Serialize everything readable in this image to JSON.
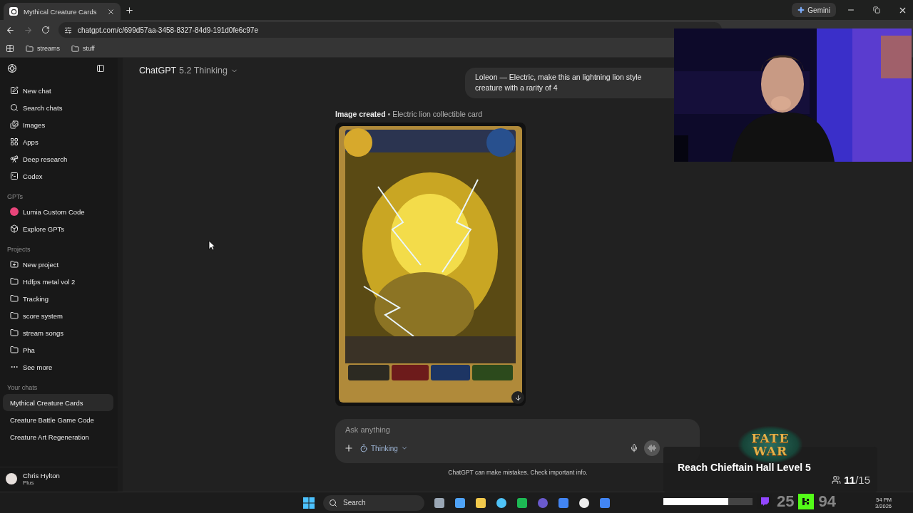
{
  "browser": {
    "tab": {
      "title": "Mythical Creature Cards",
      "selected": true
    },
    "gemini": "Gemini",
    "forward": {
      "disabled": true
    },
    "url": "chatgpt.com/c/699d57aa-3458-8327-84d9-191d0fe6c97e",
    "bookmarks": [
      {
        "label": "streams"
      },
      {
        "label": "stuff"
      }
    ]
  },
  "sidebar": {
    "nav": [
      {
        "label": "New chat"
      },
      {
        "label": "Search chats"
      },
      {
        "label": "Images"
      },
      {
        "label": "Apps"
      },
      {
        "label": "Deep research"
      },
      {
        "label": "Codex"
      }
    ],
    "gpts": {
      "title": "GPTs",
      "items": [
        {
          "label": "Lumia Custom Code",
          "color": "#e8457a"
        },
        {
          "label": "Explore GPTs"
        }
      ]
    },
    "projects": {
      "title": "Projects",
      "items": [
        {
          "label": "New project"
        },
        {
          "label": "Hdfps metal vol 2"
        },
        {
          "label": "Tracking"
        },
        {
          "label": "score system"
        },
        {
          "label": "stream songs"
        },
        {
          "label": "Pha"
        }
      ]
    },
    "see_more": "See more",
    "chats": {
      "title": "Your chats",
      "items": [
        {
          "label": "Mythical Creature Cards",
          "selected": true
        },
        {
          "label": "Creature Battle Game Code",
          "selected": false
        },
        {
          "label": "Creature Art Regeneration",
          "selected": false
        }
      ]
    },
    "user": {
      "name": "Chris Hylton",
      "plan": "Plus"
    }
  },
  "chat": {
    "model": "ChatGPT",
    "version": "5.2 Thinking",
    "user_message": "Loleon — Electric, make this an lightning lion style creature with a rarity of 4",
    "image_caption": "**Image created** • Electric lion collectible card",
    "composer": {
      "placeholder": "Ask anything",
      "mode": "Thinking"
    },
    "disclaimer": "ChatGPT can make mistakes. Check important info."
  },
  "stream_overlay": {
    "logo": [
      "FATE",
      "WAR"
    ],
    "goal": "Reach Chieftain Hall Level 5",
    "count": "**11**/15",
    "level": 0.73,
    "twitch_count": "25",
    "kick_count": "94"
  },
  "taskbar": {
    "search": "Search",
    "time": "54 PM",
    "date": "3/2026"
  }
}
